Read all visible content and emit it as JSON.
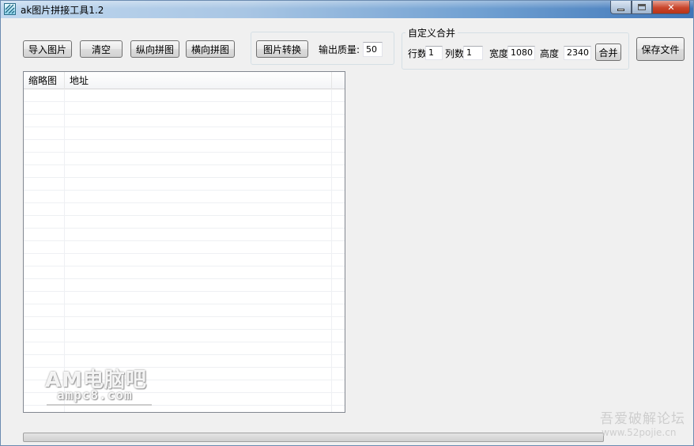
{
  "window": {
    "title": "ak图片拼接工具1.2"
  },
  "toolbar": {
    "import_label": "导入图片",
    "clear_label": "清空",
    "vertical_label": "纵向拼图",
    "horizontal_label": "横向拼图",
    "convert_label": "图片转换",
    "quality_label": "输出质量:",
    "quality_value": "50",
    "save_label": "保存文件"
  },
  "custom_merge": {
    "title": "自定义合并",
    "rows_label": "行数",
    "rows_value": "1",
    "cols_label": "列数",
    "cols_value": "1",
    "width_label": "宽度",
    "width_value": "1080",
    "height_label": "高度",
    "height_value": "2340",
    "merge_label": "合并"
  },
  "list": {
    "columns": [
      "缩略图",
      "地址"
    ]
  },
  "watermarks": {
    "brand": "AM电脑吧",
    "brand_url": "ampc8.com",
    "forum": "吾爱破解论坛",
    "forum_url": "www.52pojie.cn"
  }
}
